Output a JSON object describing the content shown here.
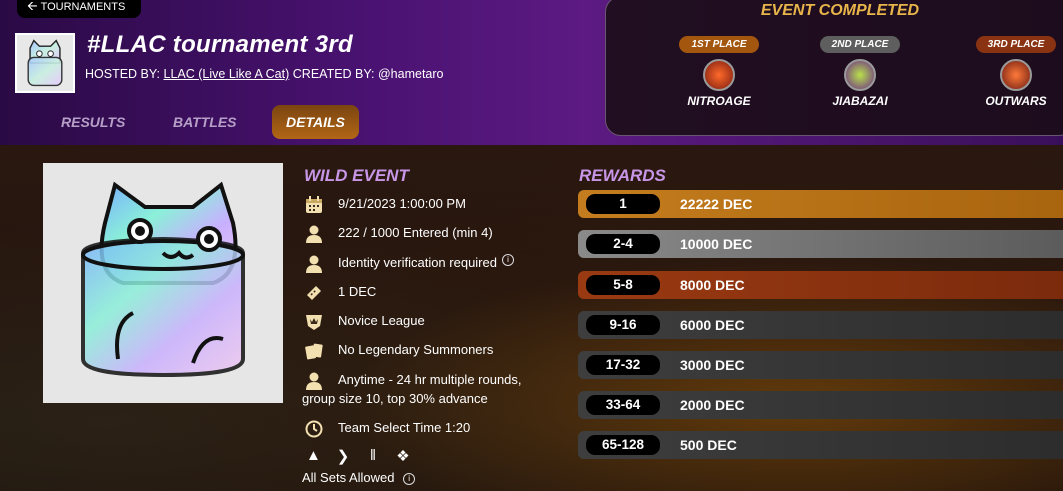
{
  "header": {
    "back_label": "TOURNAMENTS",
    "title": "#LLAC tournament 3rd",
    "hosted_by_label": "HOSTED BY:",
    "host_name": "LLAC (Live Like A Cat)",
    "created_by_label": "CREATED BY:",
    "creator": "@hametaro",
    "tabs": [
      "RESULTS",
      "BATTLES",
      "DETAILS"
    ],
    "active_tab": "DETAILS"
  },
  "event_result": {
    "title": "EVENT COMPLETED",
    "places": [
      {
        "badge": "1ST PLACE",
        "name": "NITROAGE",
        "color": "#a3570e"
      },
      {
        "badge": "2ND PLACE",
        "name": "JIABAZAI",
        "color": "#5e5e5e"
      },
      {
        "badge": "3RD PLACE",
        "name": "OUTWARS",
        "color": "#8a3312"
      }
    ]
  },
  "details": {
    "heading": "WILD EVENT",
    "start": "9/21/2023 1:00:00 PM",
    "entered": "222 / 1000 Entered (min 4)",
    "identity": "Identity verification required",
    "fee": "1 DEC",
    "league": "Novice League",
    "summoners": "No Legendary Summoners",
    "format_line1": "Anytime - 24 hr multiple rounds,",
    "format_line2": "group size 10, top 30% advance",
    "team_select": "Team Select Time 1:20",
    "sets_allowed": "All Sets Allowed",
    "set_icons": [
      "alpha-set-icon",
      "beta-set-icon",
      "untamed-set-icon",
      "chaos-set-icon"
    ]
  },
  "rewards": {
    "heading": "REWARDS",
    "rows": [
      {
        "rank": "1",
        "amount": "22222 DEC",
        "color": "#b8731a"
      },
      {
        "rank": "2-4",
        "amount": "10000 DEC",
        "color": "#6a6a6a"
      },
      {
        "rank": "5-8",
        "amount": "8000 DEC",
        "color": "#8d3410"
      },
      {
        "rank": "9-16",
        "amount": "6000 DEC",
        "color": "#333333"
      },
      {
        "rank": "17-32",
        "amount": "3000 DEC",
        "color": "#333333"
      },
      {
        "rank": "33-64",
        "amount": "2000 DEC",
        "color": "#333333"
      },
      {
        "rank": "65-128",
        "amount": "500 DEC",
        "color": "#333333"
      }
    ]
  },
  "colors": {
    "accent_gold": "#e8b54a",
    "accent_purple": "#c796e6"
  }
}
